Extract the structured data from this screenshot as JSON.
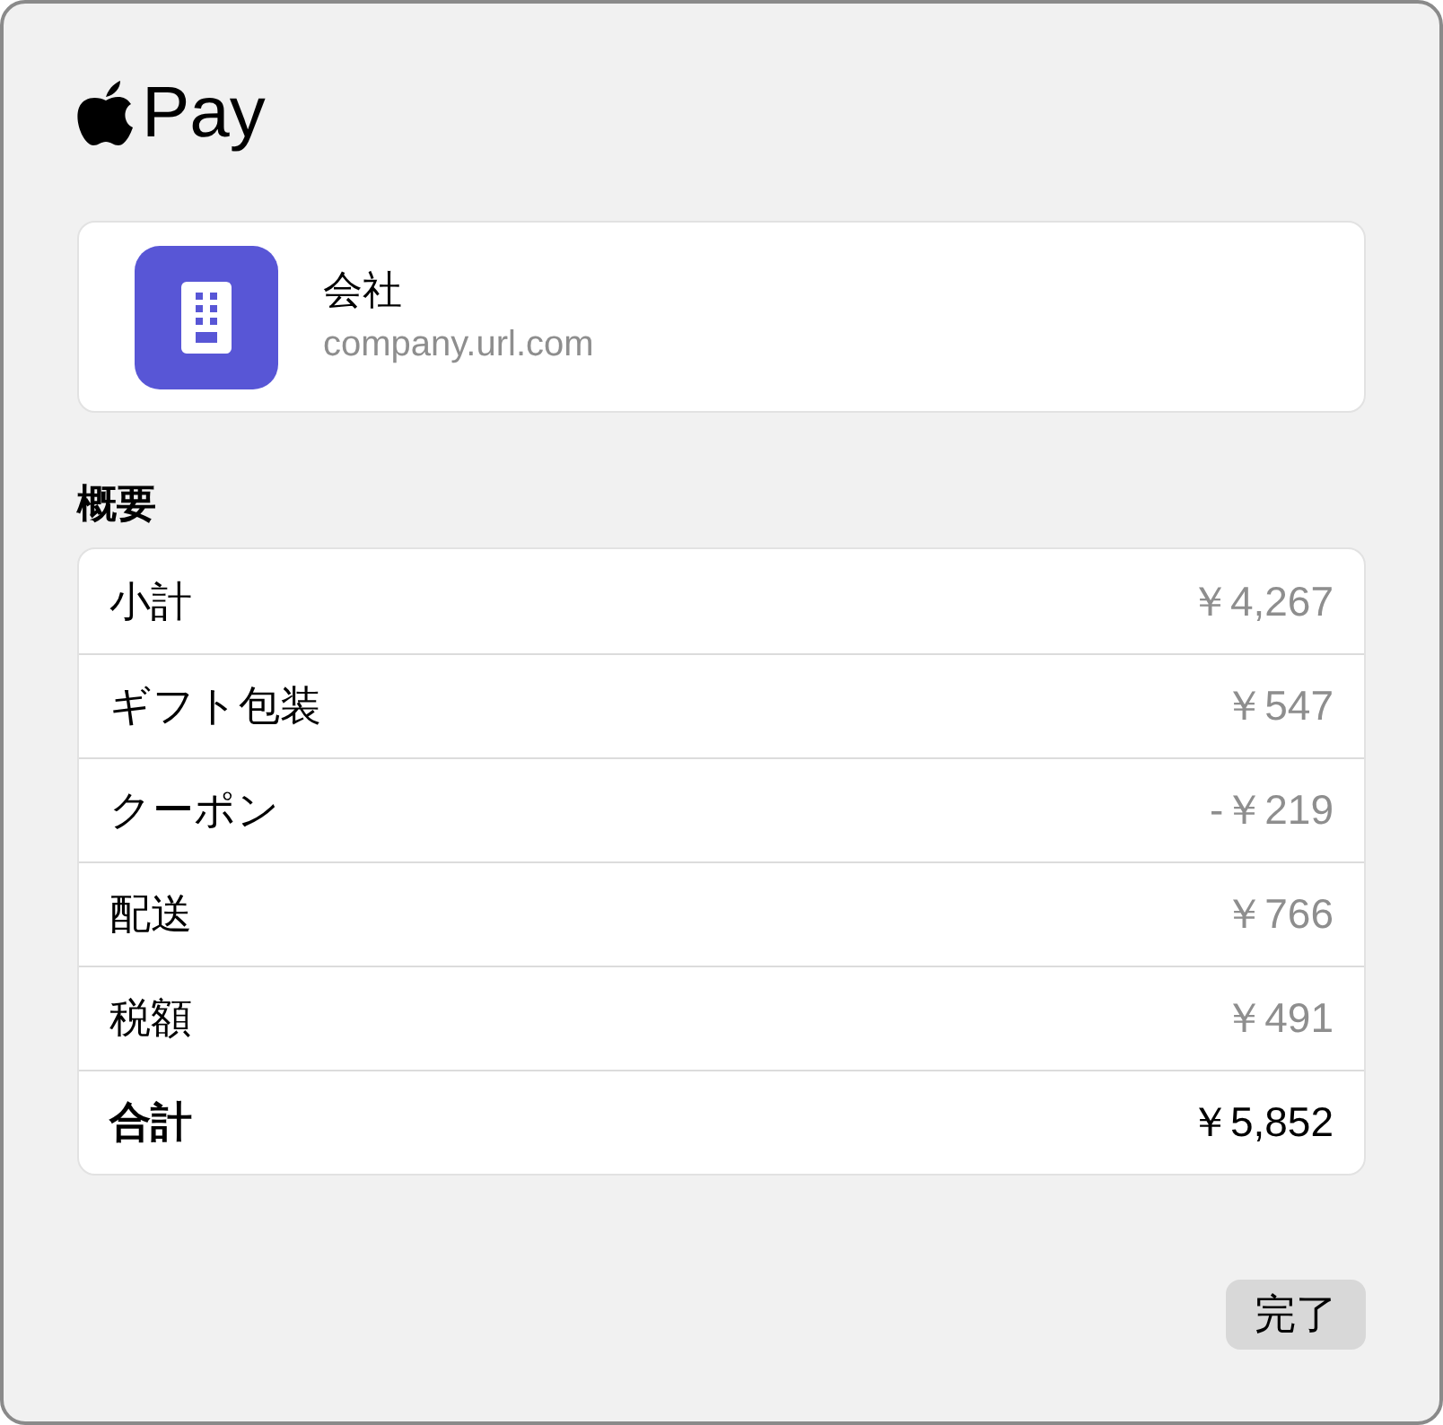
{
  "header": {
    "brand": "Pay"
  },
  "merchant": {
    "name": "会社",
    "url": "company.url.com"
  },
  "summary": {
    "title": "概要",
    "rows": [
      {
        "kind": "item",
        "label": "小計",
        "amount": "￥4,267"
      },
      {
        "kind": "item",
        "label": "ギフト包装",
        "amount": "￥547"
      },
      {
        "kind": "item",
        "label": "クーポン",
        "amount": "-￥219"
      },
      {
        "kind": "item",
        "label": "配送",
        "amount": "￥766"
      },
      {
        "kind": "item",
        "label": "税額",
        "amount": "￥491"
      },
      {
        "kind": "total",
        "label": "合計",
        "amount": "￥5,852"
      }
    ]
  },
  "buttons": [
    "完了"
  ]
}
